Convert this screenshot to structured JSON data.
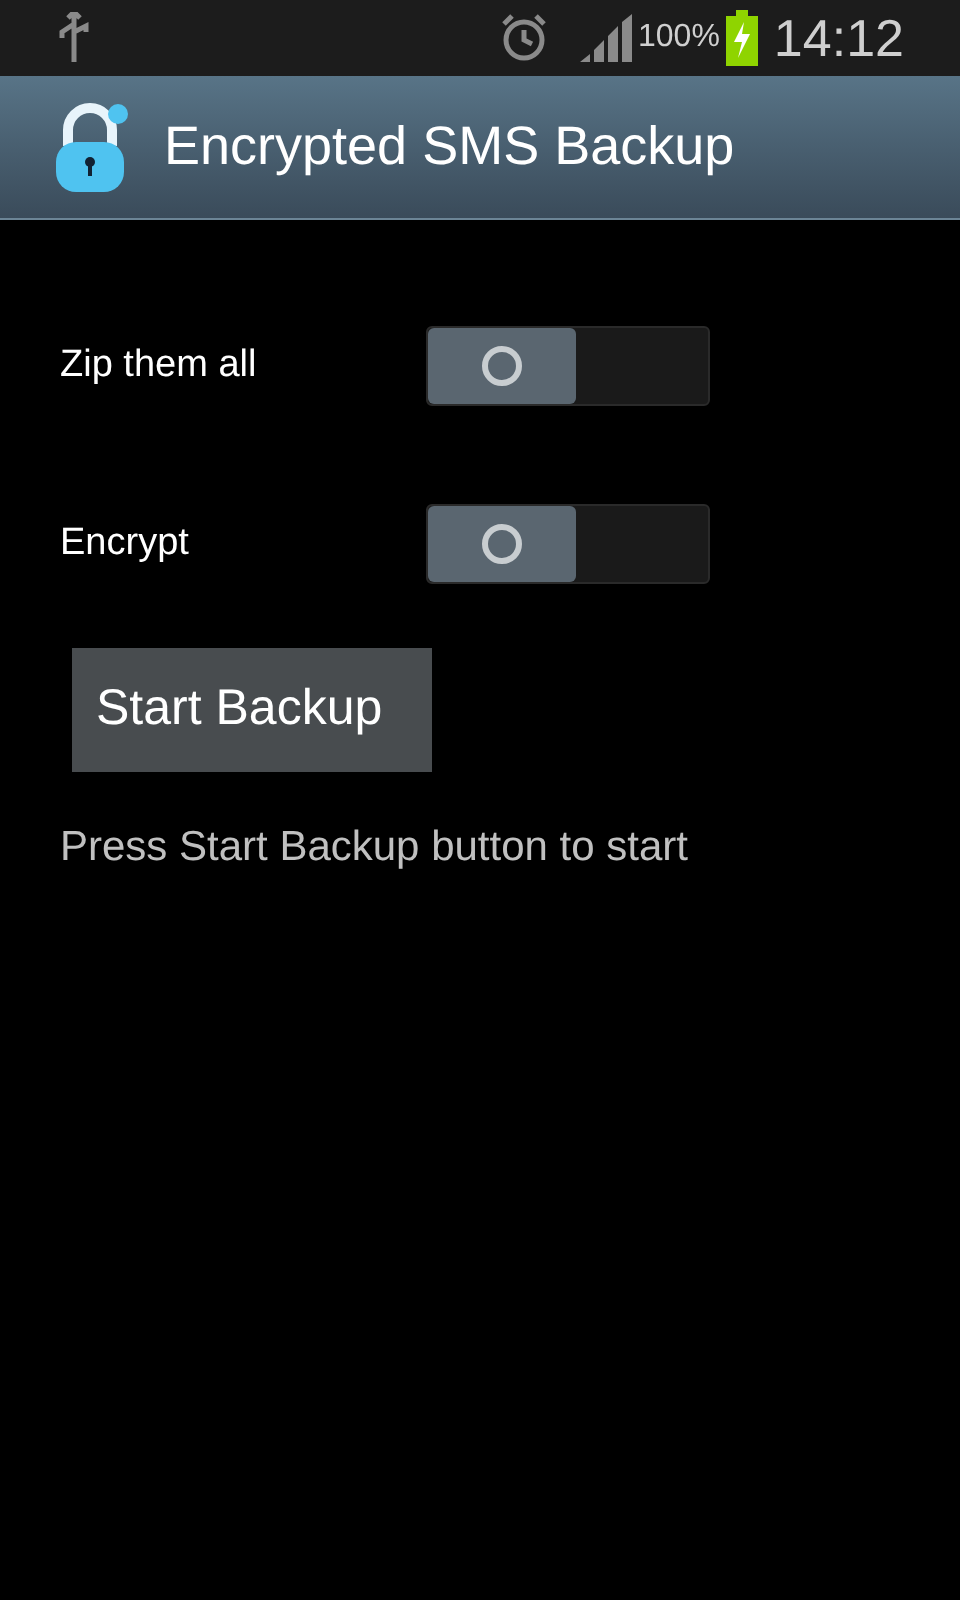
{
  "status_bar": {
    "battery": "100%",
    "time": "14:12"
  },
  "action_bar": {
    "title": "Encrypted SMS Backup"
  },
  "settings": [
    {
      "label": "Zip them all",
      "on": false
    },
    {
      "label": "Encrypt",
      "on": false
    }
  ],
  "button": "Start Backup",
  "status_text": "Press Start Backup button to start"
}
